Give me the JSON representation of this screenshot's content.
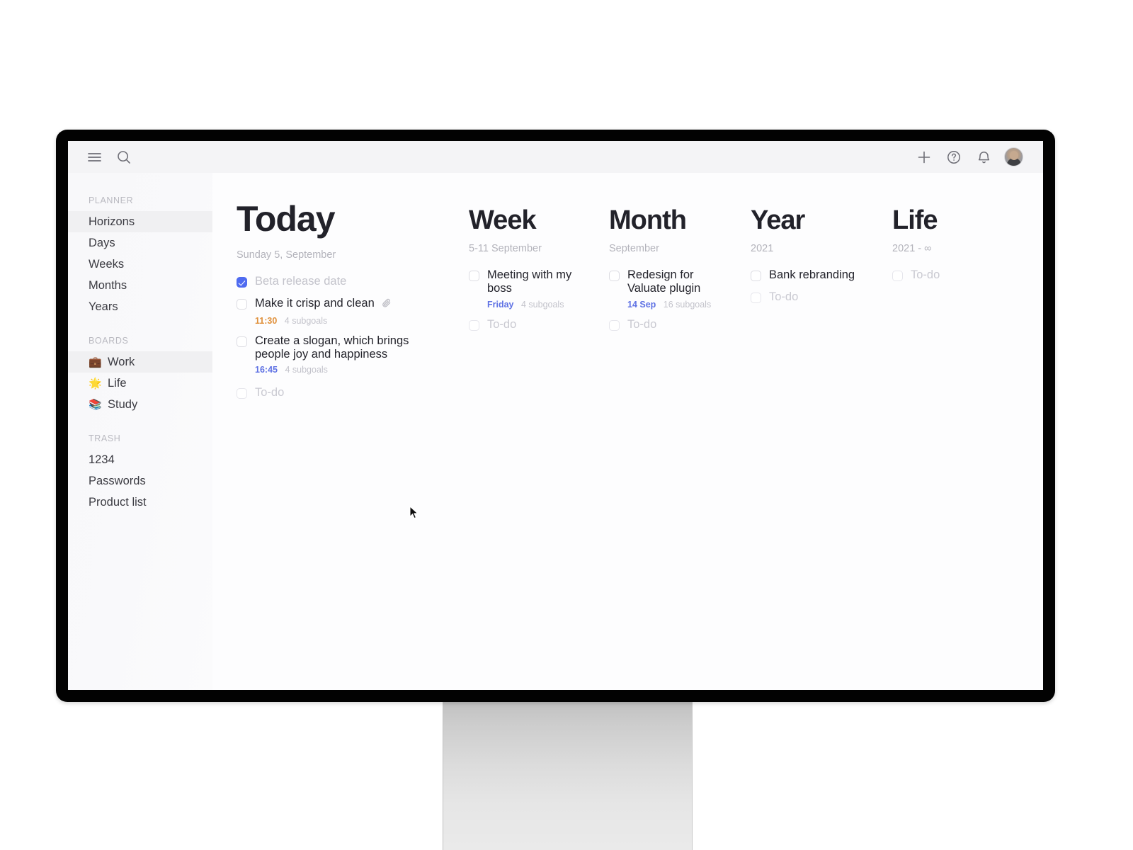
{
  "topbar": {
    "menu_icon": "hamburger-menu-icon",
    "search_icon": "search-icon",
    "add_icon": "plus-icon",
    "help_icon": "help-circle-icon",
    "notifications_icon": "bell-icon",
    "avatar": "user-avatar"
  },
  "sidebar": {
    "groups": [
      {
        "title": "PLANNER",
        "items": [
          {
            "label": "Horizons",
            "emoji": "",
            "active": true
          },
          {
            "label": "Days",
            "emoji": "",
            "active": false
          },
          {
            "label": "Weeks",
            "emoji": "",
            "active": false
          },
          {
            "label": "Months",
            "emoji": "",
            "active": false
          },
          {
            "label": "Years",
            "emoji": "",
            "active": false
          }
        ]
      },
      {
        "title": "BOARDS",
        "items": [
          {
            "label": "Work",
            "emoji": "💼",
            "active": true
          },
          {
            "label": "Life",
            "emoji": "🌟",
            "active": false
          },
          {
            "label": "Study",
            "emoji": "📚",
            "active": false
          }
        ]
      },
      {
        "title": "TRASH",
        "items": [
          {
            "label": "1234",
            "emoji": "",
            "active": false
          },
          {
            "label": "Passwords",
            "emoji": "",
            "active": false
          },
          {
            "label": "Product list",
            "emoji": "",
            "active": false
          }
        ]
      }
    ]
  },
  "columns": [
    {
      "title": "Today",
      "subtitle": "Sunday 5, September",
      "tasks": [
        {
          "title": "Beta release date",
          "checked": true,
          "done": true,
          "time": "",
          "time_color": "",
          "subgoals": "",
          "attachment": false
        },
        {
          "title": "Make it crisp and clean",
          "checked": false,
          "done": false,
          "time": "11:30",
          "time_color": "orange",
          "subgoals": "4 subgoals",
          "attachment": true
        },
        {
          "title": "Create a slogan, which brings people joy and happiness",
          "checked": false,
          "done": false,
          "time": "16:45",
          "time_color": "blue",
          "subgoals": "4 subgoals",
          "attachment": false
        },
        {
          "title": "To-do",
          "checked": false,
          "done": false,
          "placeholder": true,
          "time": "",
          "time_color": "",
          "subgoals": "",
          "attachment": false
        }
      ]
    },
    {
      "title": "Week",
      "subtitle": "5-11 September",
      "tasks": [
        {
          "title": "Meeting with my boss",
          "checked": false,
          "done": false,
          "time": "Friday",
          "time_color": "blue",
          "subgoals": "4 subgoals",
          "attachment": false
        },
        {
          "title": "To-do",
          "checked": false,
          "done": false,
          "placeholder": true,
          "time": "",
          "time_color": "",
          "subgoals": "",
          "attachment": false
        }
      ]
    },
    {
      "title": "Month",
      "subtitle": "September",
      "tasks": [
        {
          "title": "Redesign for Valuate plugin",
          "checked": false,
          "done": false,
          "time": "14 Sep",
          "time_color": "blue",
          "subgoals": "16 subgoals",
          "attachment": false
        },
        {
          "title": "To-do",
          "checked": false,
          "done": false,
          "placeholder": true,
          "time": "",
          "time_color": "",
          "subgoals": "",
          "attachment": false
        }
      ]
    },
    {
      "title": "Year",
      "subtitle": "2021",
      "tasks": [
        {
          "title": "Bank rebranding",
          "checked": false,
          "done": false,
          "time": "",
          "time_color": "",
          "subgoals": "",
          "attachment": false
        },
        {
          "title": "To-do",
          "checked": false,
          "done": false,
          "placeholder": true,
          "time": "",
          "time_color": "",
          "subgoals": "",
          "attachment": false
        }
      ]
    },
    {
      "title": "Life",
      "subtitle": "2021 - ∞",
      "tasks": [
        {
          "title": "To-do",
          "checked": false,
          "done": false,
          "placeholder": true,
          "time": "",
          "time_color": "",
          "subgoals": "",
          "attachment": false
        }
      ]
    }
  ],
  "colors": {
    "accent": "#4f6bf0",
    "accent_text": "#5f72e4",
    "warning_text": "#e0913c",
    "muted_text": "#c3c3cb",
    "heading": "#22222a"
  }
}
